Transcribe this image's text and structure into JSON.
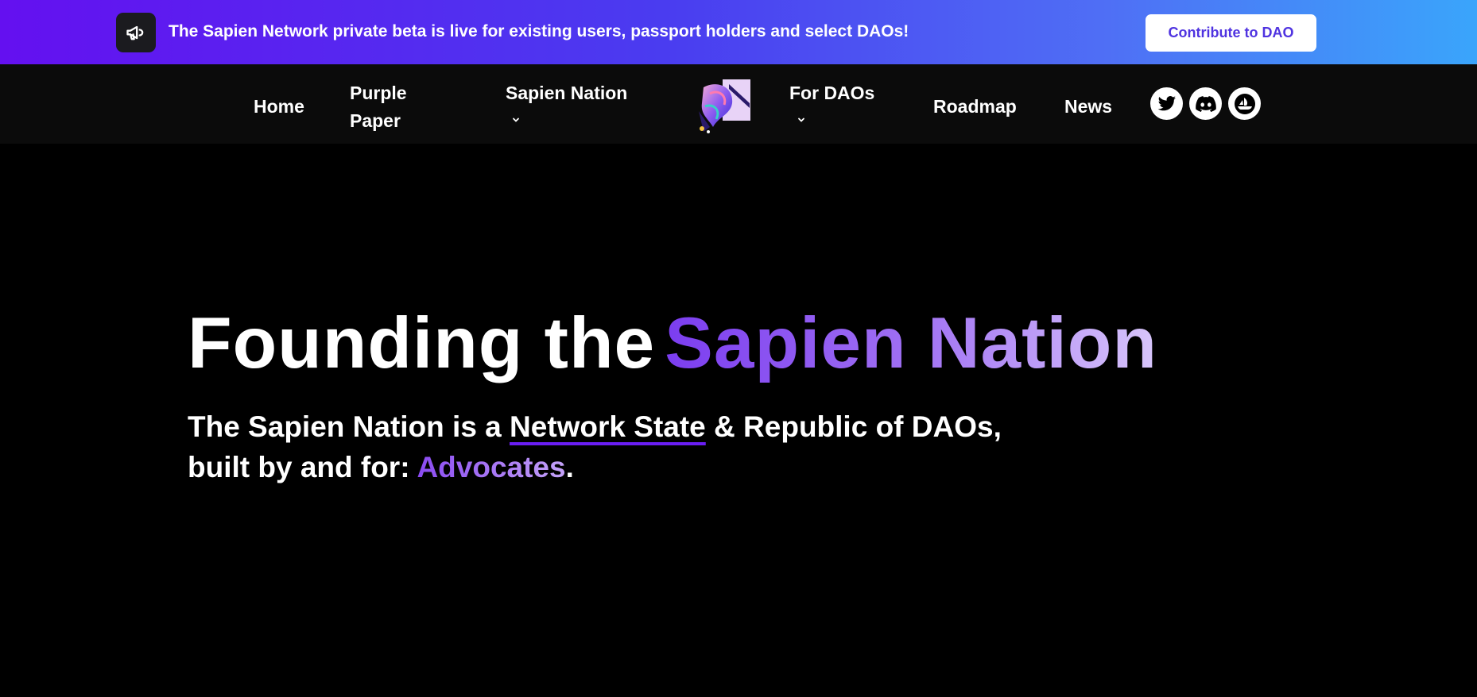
{
  "banner": {
    "icon": "megaphone-icon",
    "text": "The Sapien Network private beta is live for existing users, passport holders and select DAOs!",
    "cta_label": "Contribute to DAO"
  },
  "nav": {
    "home": "Home",
    "purple_paper": "Purple Paper",
    "sapien_nation": "Sapien Nation",
    "for_daos": "For DAOs",
    "roadmap": "Roadmap",
    "news": "News",
    "logo": "sapien-logo",
    "socials": [
      "twitter-icon",
      "discord-icon",
      "opensea-icon"
    ]
  },
  "hero": {
    "title_white": "Founding the",
    "title_gradient": "Sapien Nation",
    "sub_pre": "The Sapien Nation is a ",
    "sub_link": "Network State",
    "sub_post": " & Republic of DAOs,",
    "sub_line2_pre": "built by and for: ",
    "sub_word": "Advocates",
    "sub_end": "."
  },
  "colors": {
    "accent": "#6a1ef3",
    "banner_start": "#6410f0",
    "banner_end": "#3aa5fb",
    "button_text": "#4f33e0"
  }
}
